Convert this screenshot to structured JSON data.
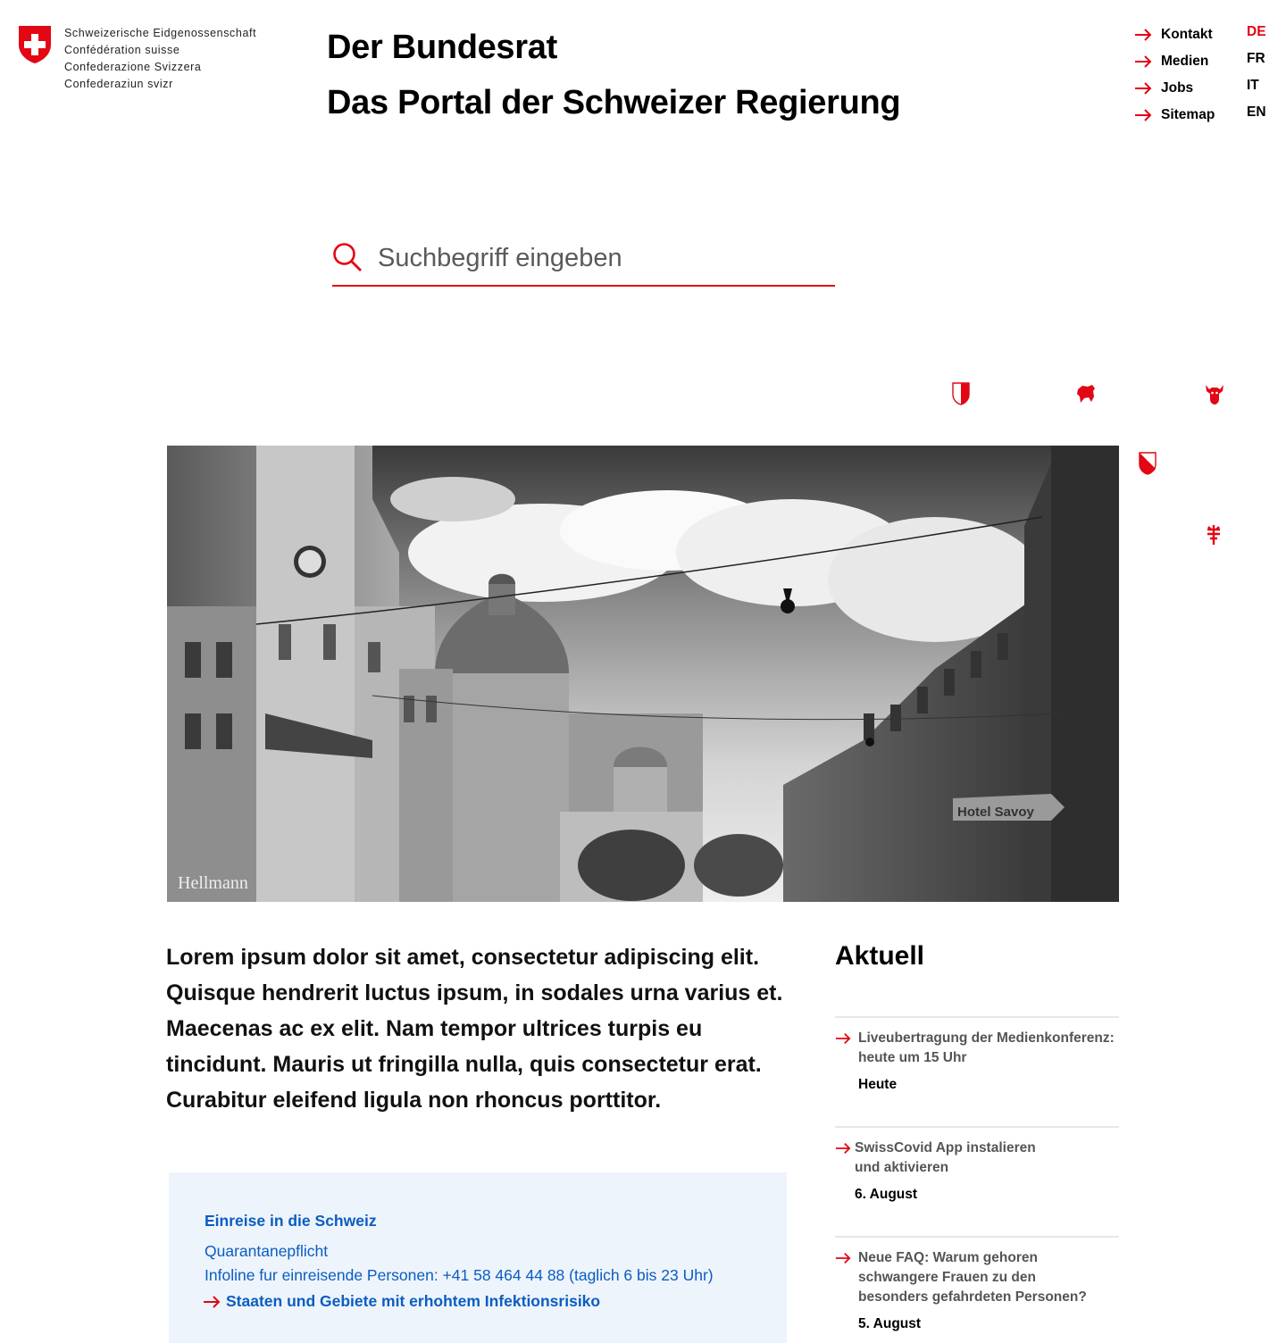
{
  "header": {
    "confederation_lines": [
      "Schweizerische Eidgenossenschaft",
      "Confédération suisse",
      "Confederazione Svizzera",
      "Confederaziun svizr"
    ],
    "title": "Der Bundesrat",
    "subtitle": "Das Portal der Schweizer Regierung"
  },
  "topnav": {
    "items": [
      {
        "label": "Kontakt",
        "icon": "arrow-right-icon"
      },
      {
        "label": "Medien",
        "icon": "arrow-right-icon"
      },
      {
        "label": "Jobs",
        "icon": "arrow-right-icon"
      },
      {
        "label": "Sitemap",
        "icon": "arrow-right-icon"
      }
    ]
  },
  "languages": {
    "items": [
      "DE",
      "FR",
      "IT",
      "EN"
    ],
    "active": "DE"
  },
  "search": {
    "placeholder": "Suchbegriff eingeben",
    "value": "",
    "icon": "search-icon"
  },
  "colors": {
    "accent_red": "#e30613",
    "link_blue": "#0a5dc2",
    "infobox_bg": "#eef4fb"
  },
  "canton_crests": [
    "zug-crest-icon",
    "appenzell-crest-icon",
    "uri-crest-icon",
    "nidwalden-crest-icon",
    "luzern-crest-icon",
    "schwyz-crest-icon",
    "obwalden-crest-icon",
    "nidwalden-crest-icon"
  ],
  "hero": {
    "image": "bern-bundeshaus-street-photo",
    "sign_text": "Hotel Savoy",
    "shop_text": "Hellmann"
  },
  "intro": {
    "text": "Lorem ipsum dolor sit amet, consectetur adipiscing elit. Quisque hendrerit luctus ipsum, in sodales urna varius et. Maecenas ac ex elit. Nam tempor ultrices turpis eu tincidunt. Mauris ut fringilla nulla, quis consectetur erat. Curabitur eleifend ligula non rhoncus porttitor."
  },
  "infobox": {
    "title": "Einreise in die Schweiz",
    "lines": [
      "Quarantanepflicht",
      "Infoline fur einreisende Personen: +41 58 464 44 88 (taglich 6 bis 23 Uhr)"
    ],
    "link": "Staaten und Gebiete mit erhohtem Infektionsrisiko"
  },
  "aktuell": {
    "heading": "Aktuell",
    "items": [
      {
        "title": "Liveubertragung der Medienkonferenz: heute um 15 Uhr",
        "date": "Heute"
      },
      {
        "title": "SwissCovid App instalieren und aktivieren",
        "date": "6. August"
      },
      {
        "title": "Neue FAQ: Warum gehoren schwangere Frauen zu den besonders gefahrdeten Personen?",
        "date": "5. August"
      }
    ]
  }
}
